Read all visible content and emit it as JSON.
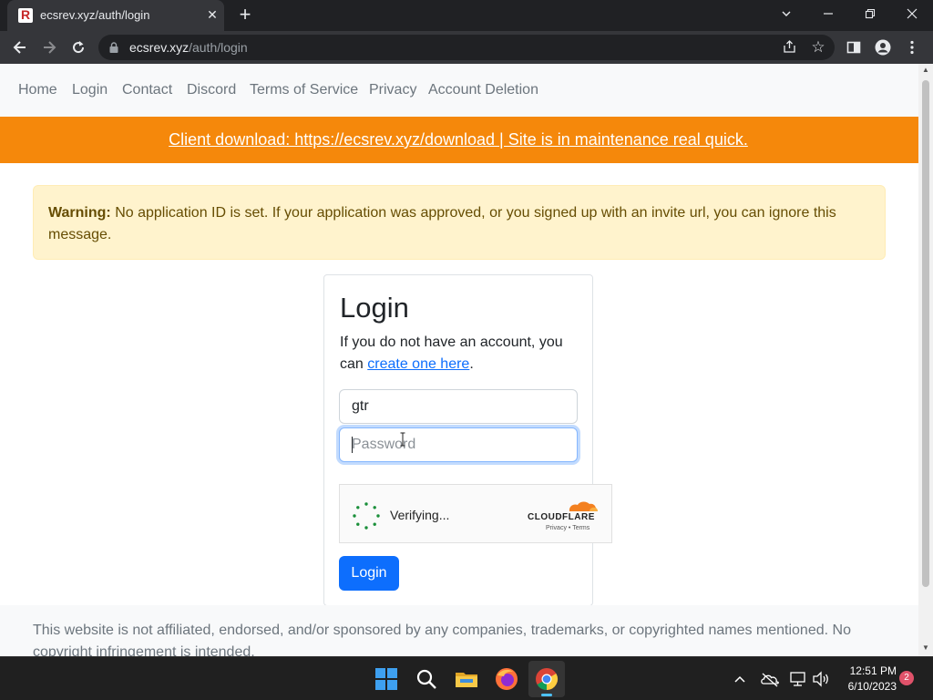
{
  "browser": {
    "tab_title": "ecsrev.xyz/auth/login",
    "tab_close_glyph": "✕",
    "new_tab_glyph": "+",
    "url_host": "ecsrev.xyz",
    "url_path": "/auth/login",
    "icons": [
      "favicon-r-icon",
      "back-arrow-icon",
      "forward-arrow-icon",
      "reload-icon",
      "lock-icon",
      "share-icon",
      "star-icon",
      "side-panel-icon",
      "profile-icon",
      "kebab-menu-icon",
      "tab-search-icon",
      "minimize-icon",
      "restore-icon",
      "close-icon"
    ]
  },
  "nav": {
    "home": "Home",
    "login": "Login",
    "contact": "Contact",
    "discord": "Discord",
    "tos": "Terms of Service",
    "privacy": "Privacy",
    "deletion": "Account Deletion"
  },
  "announcement": {
    "text": "Client download: https://ecsrev.xyz/download | Site is in maintenance real quick.",
    "bg_color": "#f5880b"
  },
  "warning": {
    "label": "Warning:",
    "message": "No application ID is set. If your application was approved, or you signed up with an invite url, you can ignore this message."
  },
  "login": {
    "title": "Login",
    "subtitle_prefix": "If you do not have an account, you can",
    "create_link": "create one here",
    "subtitle_suffix": ".",
    "username_value": "gtr",
    "password_placeholder": "Password",
    "captcha_status": "Verifying...",
    "captcha_brand": "CLOUDFLARE",
    "captcha_privacy": "Privacy",
    "captcha_separator": "•",
    "captcha_terms": "Terms",
    "submit_label": "Login",
    "accent_color": "#0d6efd"
  },
  "footer": {
    "text": "This website is not affiliated, endorsed, and/or sponsored by any companies, trademarks, or copyrighted names mentioned. No copyright infringement is intended."
  },
  "taskbar": {
    "apps": [
      "windows-start-icon",
      "search-icon",
      "file-explorer-icon",
      "firefox-icon",
      "chrome-icon"
    ],
    "time": "12:51 PM",
    "date": "6/10/2023",
    "notification_count": "2"
  }
}
